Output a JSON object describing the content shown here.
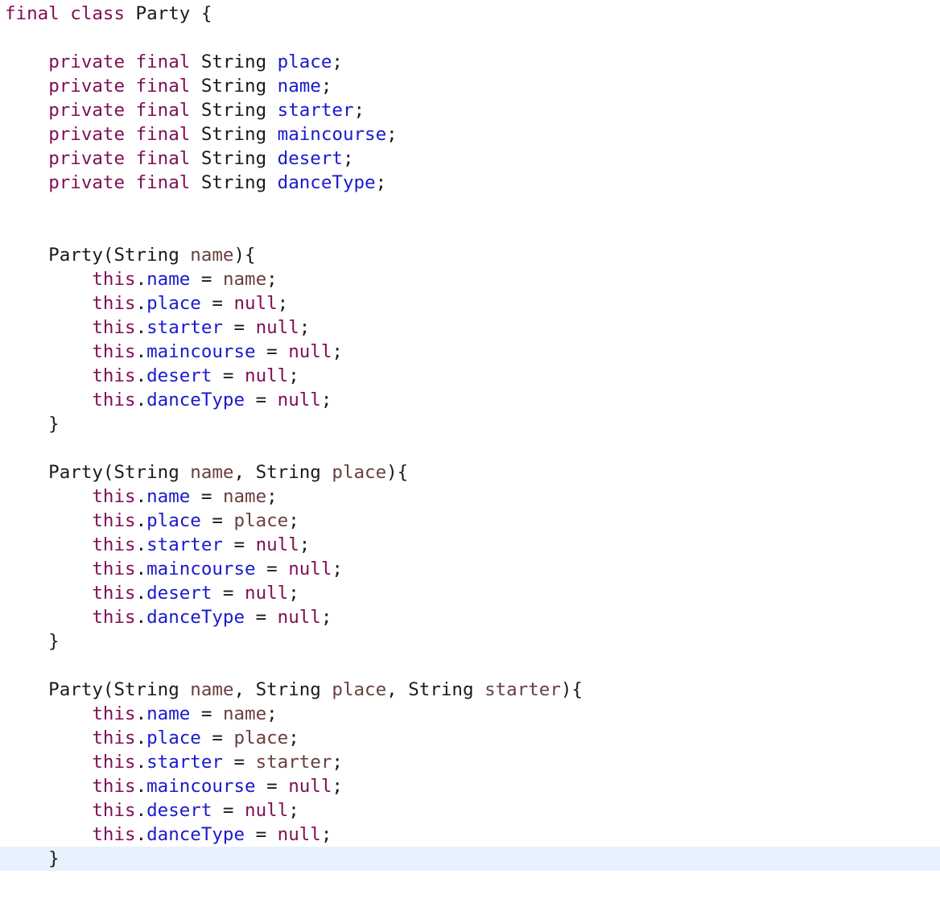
{
  "editor": {
    "colors": {
      "background": "#ffffff",
      "keyword": "#7f0e55",
      "field": "#1a1acc",
      "parameter": "#6a3e3e",
      "plain": "#1a1a1a",
      "current_line_highlight": "#e7f1fd"
    },
    "current_line": 35,
    "lines": [
      [
        [
          "keyword",
          "final"
        ],
        [
          "plain",
          " "
        ],
        [
          "keyword",
          "class"
        ],
        [
          "plain",
          " Party {"
        ]
      ],
      [],
      [
        [
          "plain",
          "    "
        ],
        [
          "keyword",
          "private"
        ],
        [
          "plain",
          " "
        ],
        [
          "keyword",
          "final"
        ],
        [
          "plain",
          " String "
        ],
        [
          "field",
          "place"
        ],
        [
          "plain",
          ";"
        ]
      ],
      [
        [
          "plain",
          "    "
        ],
        [
          "keyword",
          "private"
        ],
        [
          "plain",
          " "
        ],
        [
          "keyword",
          "final"
        ],
        [
          "plain",
          " String "
        ],
        [
          "field",
          "name"
        ],
        [
          "plain",
          ";"
        ]
      ],
      [
        [
          "plain",
          "    "
        ],
        [
          "keyword",
          "private"
        ],
        [
          "plain",
          " "
        ],
        [
          "keyword",
          "final"
        ],
        [
          "plain",
          " String "
        ],
        [
          "field",
          "starter"
        ],
        [
          "plain",
          ";"
        ]
      ],
      [
        [
          "plain",
          "    "
        ],
        [
          "keyword",
          "private"
        ],
        [
          "plain",
          " "
        ],
        [
          "keyword",
          "final"
        ],
        [
          "plain",
          " String "
        ],
        [
          "field",
          "maincourse"
        ],
        [
          "plain",
          ";"
        ]
      ],
      [
        [
          "plain",
          "    "
        ],
        [
          "keyword",
          "private"
        ],
        [
          "plain",
          " "
        ],
        [
          "keyword",
          "final"
        ],
        [
          "plain",
          " String "
        ],
        [
          "field",
          "desert"
        ],
        [
          "plain",
          ";"
        ]
      ],
      [
        [
          "plain",
          "    "
        ],
        [
          "keyword",
          "private"
        ],
        [
          "plain",
          " "
        ],
        [
          "keyword",
          "final"
        ],
        [
          "plain",
          " String "
        ],
        [
          "field",
          "danceType"
        ],
        [
          "plain",
          ";"
        ]
      ],
      [],
      [],
      [
        [
          "plain",
          "    Party(String "
        ],
        [
          "param",
          "name"
        ],
        [
          "plain",
          "){"
        ]
      ],
      [
        [
          "plain",
          "        "
        ],
        [
          "keyword",
          "this"
        ],
        [
          "plain",
          "."
        ],
        [
          "field",
          "name"
        ],
        [
          "plain",
          " = "
        ],
        [
          "param",
          "name"
        ],
        [
          "plain",
          ";"
        ]
      ],
      [
        [
          "plain",
          "        "
        ],
        [
          "keyword",
          "this"
        ],
        [
          "plain",
          "."
        ],
        [
          "field",
          "place"
        ],
        [
          "plain",
          " = "
        ],
        [
          "keyword",
          "null"
        ],
        [
          "plain",
          ";"
        ]
      ],
      [
        [
          "plain",
          "        "
        ],
        [
          "keyword",
          "this"
        ],
        [
          "plain",
          "."
        ],
        [
          "field",
          "starter"
        ],
        [
          "plain",
          " = "
        ],
        [
          "keyword",
          "null"
        ],
        [
          "plain",
          ";"
        ]
      ],
      [
        [
          "plain",
          "        "
        ],
        [
          "keyword",
          "this"
        ],
        [
          "plain",
          "."
        ],
        [
          "field",
          "maincourse"
        ],
        [
          "plain",
          " = "
        ],
        [
          "keyword",
          "null"
        ],
        [
          "plain",
          ";"
        ]
      ],
      [
        [
          "plain",
          "        "
        ],
        [
          "keyword",
          "this"
        ],
        [
          "plain",
          "."
        ],
        [
          "field",
          "desert"
        ],
        [
          "plain",
          " = "
        ],
        [
          "keyword",
          "null"
        ],
        [
          "plain",
          ";"
        ]
      ],
      [
        [
          "plain",
          "        "
        ],
        [
          "keyword",
          "this"
        ],
        [
          "plain",
          "."
        ],
        [
          "field",
          "danceType"
        ],
        [
          "plain",
          " = "
        ],
        [
          "keyword",
          "null"
        ],
        [
          "plain",
          ";"
        ]
      ],
      [
        [
          "plain",
          "    }"
        ]
      ],
      [],
      [
        [
          "plain",
          "    Party(String "
        ],
        [
          "param",
          "name"
        ],
        [
          "plain",
          ", String "
        ],
        [
          "param",
          "place"
        ],
        [
          "plain",
          "){"
        ]
      ],
      [
        [
          "plain",
          "        "
        ],
        [
          "keyword",
          "this"
        ],
        [
          "plain",
          "."
        ],
        [
          "field",
          "name"
        ],
        [
          "plain",
          " = "
        ],
        [
          "param",
          "name"
        ],
        [
          "plain",
          ";"
        ]
      ],
      [
        [
          "plain",
          "        "
        ],
        [
          "keyword",
          "this"
        ],
        [
          "plain",
          "."
        ],
        [
          "field",
          "place"
        ],
        [
          "plain",
          " = "
        ],
        [
          "param",
          "place"
        ],
        [
          "plain",
          ";"
        ]
      ],
      [
        [
          "plain",
          "        "
        ],
        [
          "keyword",
          "this"
        ],
        [
          "plain",
          "."
        ],
        [
          "field",
          "starter"
        ],
        [
          "plain",
          " = "
        ],
        [
          "keyword",
          "null"
        ],
        [
          "plain",
          ";"
        ]
      ],
      [
        [
          "plain",
          "        "
        ],
        [
          "keyword",
          "this"
        ],
        [
          "plain",
          "."
        ],
        [
          "field",
          "maincourse"
        ],
        [
          "plain",
          " = "
        ],
        [
          "keyword",
          "null"
        ],
        [
          "plain",
          ";"
        ]
      ],
      [
        [
          "plain",
          "        "
        ],
        [
          "keyword",
          "this"
        ],
        [
          "plain",
          "."
        ],
        [
          "field",
          "desert"
        ],
        [
          "plain",
          " = "
        ],
        [
          "keyword",
          "null"
        ],
        [
          "plain",
          ";"
        ]
      ],
      [
        [
          "plain",
          "        "
        ],
        [
          "keyword",
          "this"
        ],
        [
          "plain",
          "."
        ],
        [
          "field",
          "danceType"
        ],
        [
          "plain",
          " = "
        ],
        [
          "keyword",
          "null"
        ],
        [
          "plain",
          ";"
        ]
      ],
      [
        [
          "plain",
          "    }"
        ]
      ],
      [],
      [
        [
          "plain",
          "    Party(String "
        ],
        [
          "param",
          "name"
        ],
        [
          "plain",
          ", String "
        ],
        [
          "param",
          "place"
        ],
        [
          "plain",
          ", String "
        ],
        [
          "param",
          "starter"
        ],
        [
          "plain",
          "){"
        ]
      ],
      [
        [
          "plain",
          "        "
        ],
        [
          "keyword",
          "this"
        ],
        [
          "plain",
          "."
        ],
        [
          "field",
          "name"
        ],
        [
          "plain",
          " = "
        ],
        [
          "param",
          "name"
        ],
        [
          "plain",
          ";"
        ]
      ],
      [
        [
          "plain",
          "        "
        ],
        [
          "keyword",
          "this"
        ],
        [
          "plain",
          "."
        ],
        [
          "field",
          "place"
        ],
        [
          "plain",
          " = "
        ],
        [
          "param",
          "place"
        ],
        [
          "plain",
          ";"
        ]
      ],
      [
        [
          "plain",
          "        "
        ],
        [
          "keyword",
          "this"
        ],
        [
          "plain",
          "."
        ],
        [
          "field",
          "starter"
        ],
        [
          "plain",
          " = "
        ],
        [
          "param",
          "starter"
        ],
        [
          "plain",
          ";"
        ]
      ],
      [
        [
          "plain",
          "        "
        ],
        [
          "keyword",
          "this"
        ],
        [
          "plain",
          "."
        ],
        [
          "field",
          "maincourse"
        ],
        [
          "plain",
          " = "
        ],
        [
          "keyword",
          "null"
        ],
        [
          "plain",
          ";"
        ]
      ],
      [
        [
          "plain",
          "        "
        ],
        [
          "keyword",
          "this"
        ],
        [
          "plain",
          "."
        ],
        [
          "field",
          "desert"
        ],
        [
          "plain",
          " = "
        ],
        [
          "keyword",
          "null"
        ],
        [
          "plain",
          ";"
        ]
      ],
      [
        [
          "plain",
          "        "
        ],
        [
          "keyword",
          "this"
        ],
        [
          "plain",
          "."
        ],
        [
          "field",
          "danceType"
        ],
        [
          "plain",
          " = "
        ],
        [
          "keyword",
          "null"
        ],
        [
          "plain",
          ";"
        ]
      ],
      [
        [
          "plain",
          "    }"
        ]
      ]
    ]
  }
}
